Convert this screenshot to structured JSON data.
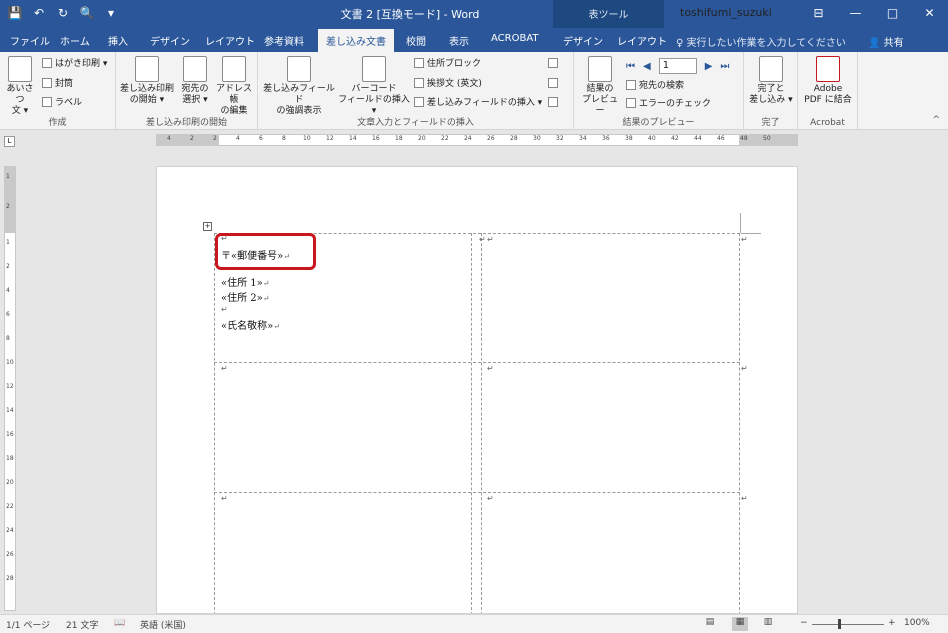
{
  "window": {
    "title": "文書 2 [互換モード] - Word",
    "context_label": "表ツール",
    "user": "toshifumi_suzuki",
    "min_glyph": "—",
    "restore_glyph": "□",
    "close_glyph": "✕",
    "ribbon_display_glyph": "⊟"
  },
  "qat": {
    "save_glyph": "💾",
    "undo_glyph": "↶",
    "redo_glyph": "↻",
    "preview_glyph": "🔍",
    "more_glyph": "▾"
  },
  "tabs": [
    "ファイル",
    "ホーム",
    "挿入",
    "デザイン",
    "レイアウト",
    "参考資料",
    "差し込み文書",
    "校閲",
    "表示",
    "ACROBAT",
    "デザイン",
    "レイアウト"
  ],
  "tellme": "実行したい作業を入力してください",
  "share": "共有",
  "ribbon": {
    "create": {
      "label": "作成",
      "greeting_line1": "あいさつ",
      "greeting_line2": "文 ▾",
      "postcard": "はがき印刷 ▾",
      "envelope": "封筒",
      "labels": "ラベル"
    },
    "start_merge": {
      "label": "差し込み印刷の開始",
      "start_l1": "差し込み印刷",
      "start_l2": "の開始 ▾",
      "select_l1": "宛先の",
      "select_l2": "選択 ▾",
      "edit_l1": "アドレス帳",
      "edit_l2": "の編集"
    },
    "write_insert": {
      "label": "文章入力とフィールドの挿入",
      "highlight_l1": "差し込みフィールド",
      "highlight_l2": "の強調表示",
      "barcode_l1": "バーコード",
      "barcode_l2": "フィールドの挿入 ▾",
      "address_block": "住所ブロック",
      "greeting_en": "挨拶文 (英文)",
      "insert_field": "差し込みフィールドの挿入 ▾"
    },
    "preview": {
      "label": "結果のプレビュー",
      "preview_l1": "結果の",
      "preview_l2": "プレビュー",
      "record": "1",
      "find": "宛先の検索",
      "check": "エラーのチェック"
    },
    "finish": {
      "label": "完了",
      "finish_l1": "完了と",
      "finish_l2": "差し込み ▾"
    },
    "acrobat": {
      "label": "Acrobat",
      "pdf_l1": "Adobe",
      "pdf_l2": "PDF に結合"
    }
  },
  "ruler": {
    "h_ticks": [
      "4",
      "2",
      "2",
      "4",
      "6",
      "8",
      "10",
      "12",
      "14",
      "16",
      "18",
      "20",
      "22",
      "24",
      "26",
      "28",
      "30",
      "32",
      "34",
      "36",
      "38",
      "40",
      "42",
      "44",
      "46",
      "48",
      "50"
    ],
    "v_ticks": [
      "1",
      "2",
      "1",
      "2",
      "4",
      "6",
      "8",
      "10",
      "12",
      "14",
      "16",
      "18",
      "20",
      "22",
      "24",
      "26",
      "28"
    ]
  },
  "document": {
    "postal": "〒«郵便番号»",
    "address1": "«住所 1»",
    "address2": "«住所 2»",
    "name": "«氏名敬称»",
    "para_mark": "↵",
    "cell_mark": "↵"
  },
  "status": {
    "page": "1/1 ページ",
    "words": "21 文字",
    "language": "英語 (米国)",
    "zoom": "100%"
  }
}
